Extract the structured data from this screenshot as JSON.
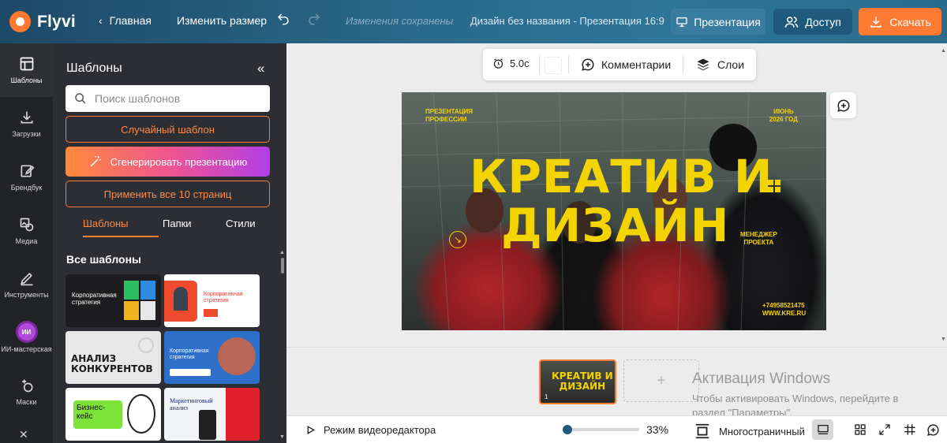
{
  "app": {
    "name": "Flyvi"
  },
  "header": {
    "back_label": "Главная",
    "resize_label": "Изменить размер",
    "saved_status": "Изменения сохранены",
    "document_title": "Дизайн без названия - Презентация 16:9",
    "present_label": "Презентация",
    "access_label": "Доступ",
    "download_label": "Скачать"
  },
  "rail": {
    "items": [
      {
        "label": "Шаблоны",
        "icon": "templates-icon"
      },
      {
        "label": "Загрузки",
        "icon": "upload-icon"
      },
      {
        "label": "Брендбук",
        "icon": "brandbook-icon"
      },
      {
        "label": "Медиа",
        "icon": "media-icon"
      },
      {
        "label": "Инструменты",
        "icon": "pencil-icon"
      },
      {
        "label": "ИИ-мастерская",
        "icon": "ai-icon",
        "badge": "ИИ"
      },
      {
        "label": "Маски",
        "icon": "mask-icon"
      }
    ]
  },
  "panel": {
    "title": "Шаблоны",
    "search_placeholder": "Поиск шаблонов",
    "random_label": "Случайный шаблон",
    "generate_label": "Сгенерировать презентацию",
    "apply_all_label": "Применить все 10 страниц",
    "tabs": [
      "Шаблоны",
      "Папки",
      "Стили"
    ],
    "section_title": "Все шаблоны",
    "templates": [
      {
        "title": "Корпоративная стратегия",
        "bg": "#1d1d1f",
        "fg": "#ffffff"
      },
      {
        "title": "Корпоративная стратегия",
        "bg": "#ffffff",
        "fg": "#e23a2f"
      },
      {
        "title": "АНАЛИЗ КОНКУРЕНТОВ",
        "bg": "#e8e8e8",
        "fg": "#1a1a1a"
      },
      {
        "title": "Корпоративная стратегия",
        "bg": "#2d6fc9",
        "fg": "#ffffff"
      },
      {
        "title": "Бизнес-кейс",
        "bg": "#ffffff",
        "fg": "#111111"
      },
      {
        "title": "Маркетинговый анализ",
        "bg": "#f2f4f8",
        "fg": "#1a2a6c"
      }
    ]
  },
  "toolbar": {
    "duration": "5.0с",
    "comments_label": "Комментарии",
    "layers_label": "Слои"
  },
  "slide": {
    "top_left": "ПРЕЗЕНТАЦИЯ\nПРОФЕССИИ",
    "top_right": "ИЮНЬ\n2026 ГОД",
    "title_line1": "КРЕАТИВ И",
    "title_line2": "ДИЗАЙН",
    "role": "МЕНЕДЖЕР\nПРОЕКТА",
    "contacts": "+74958521475\nWWW.KRE.RU",
    "accent": "#f4d400"
  },
  "pages": {
    "thumbnail_title": "КРЕАТИВ И\nДИЗАЙН",
    "page_number": "1",
    "add_symbol": "+"
  },
  "activation": {
    "title": "Активация Windows",
    "subtitle_line1": "Чтобы активировать Windows, перейдите в",
    "subtitle_line2": "раздел \"Параметры\"."
  },
  "bottombar": {
    "video_mode_label": "Режим видеоредактора",
    "zoom": "33%",
    "zoom_fraction": 0.05,
    "multipage_label": "Многостраничный"
  }
}
